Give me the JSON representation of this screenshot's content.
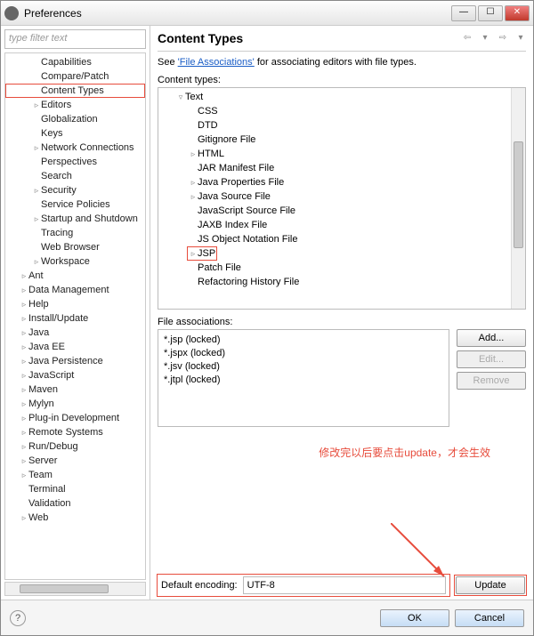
{
  "window": {
    "title": "Preferences"
  },
  "sidebar": {
    "filter_placeholder": "type filter text",
    "items": [
      {
        "label": "Capabilities",
        "depth": 2,
        "exp": ""
      },
      {
        "label": "Compare/Patch",
        "depth": 2,
        "exp": ""
      },
      {
        "label": "Content Types",
        "depth": 2,
        "exp": "",
        "highlight": true
      },
      {
        "label": "Editors",
        "depth": 2,
        "exp": "▹"
      },
      {
        "label": "Globalization",
        "depth": 2,
        "exp": ""
      },
      {
        "label": "Keys",
        "depth": 2,
        "exp": ""
      },
      {
        "label": "Network Connections",
        "depth": 2,
        "exp": "▹"
      },
      {
        "label": "Perspectives",
        "depth": 2,
        "exp": ""
      },
      {
        "label": "Search",
        "depth": 2,
        "exp": ""
      },
      {
        "label": "Security",
        "depth": 2,
        "exp": "▹"
      },
      {
        "label": "Service Policies",
        "depth": 2,
        "exp": ""
      },
      {
        "label": "Startup and Shutdown",
        "depth": 2,
        "exp": "▹"
      },
      {
        "label": "Tracing",
        "depth": 2,
        "exp": ""
      },
      {
        "label": "Web Browser",
        "depth": 2,
        "exp": ""
      },
      {
        "label": "Workspace",
        "depth": 2,
        "exp": "▹"
      },
      {
        "label": "Ant",
        "depth": 1,
        "exp": "▹"
      },
      {
        "label": "Data Management",
        "depth": 1,
        "exp": "▹"
      },
      {
        "label": "Help",
        "depth": 1,
        "exp": "▹"
      },
      {
        "label": "Install/Update",
        "depth": 1,
        "exp": "▹"
      },
      {
        "label": "Java",
        "depth": 1,
        "exp": "▹"
      },
      {
        "label": "Java EE",
        "depth": 1,
        "exp": "▹"
      },
      {
        "label": "Java Persistence",
        "depth": 1,
        "exp": "▹"
      },
      {
        "label": "JavaScript",
        "depth": 1,
        "exp": "▹"
      },
      {
        "label": "Maven",
        "depth": 1,
        "exp": "▹"
      },
      {
        "label": "Mylyn",
        "depth": 1,
        "exp": "▹"
      },
      {
        "label": "Plug-in Development",
        "depth": 1,
        "exp": "▹"
      },
      {
        "label": "Remote Systems",
        "depth": 1,
        "exp": "▹"
      },
      {
        "label": "Run/Debug",
        "depth": 1,
        "exp": "▹"
      },
      {
        "label": "Server",
        "depth": 1,
        "exp": "▹"
      },
      {
        "label": "Team",
        "depth": 1,
        "exp": "▹"
      },
      {
        "label": "Terminal",
        "depth": 1,
        "exp": ""
      },
      {
        "label": "Validation",
        "depth": 1,
        "exp": ""
      },
      {
        "label": "Web",
        "depth": 1,
        "exp": "▹"
      }
    ]
  },
  "content": {
    "title": "Content Types",
    "desc_prefix": "See ",
    "desc_link": "'File Associations'",
    "desc_suffix": " for associating editors with file types.",
    "ct_label": "Content types:",
    "ct_items": [
      {
        "label": "Text",
        "depth": 0,
        "exp": "▿"
      },
      {
        "label": "CSS",
        "depth": 1,
        "exp": ""
      },
      {
        "label": "DTD",
        "depth": 1,
        "exp": ""
      },
      {
        "label": "Gitignore File",
        "depth": 1,
        "exp": ""
      },
      {
        "label": "HTML",
        "depth": 1,
        "exp": "▹"
      },
      {
        "label": "JAR Manifest File",
        "depth": 1,
        "exp": ""
      },
      {
        "label": "Java Properties File",
        "depth": 1,
        "exp": "▹"
      },
      {
        "label": "Java Source File",
        "depth": 1,
        "exp": "▹"
      },
      {
        "label": "JavaScript Source File",
        "depth": 1,
        "exp": ""
      },
      {
        "label": "JAXB Index File",
        "depth": 1,
        "exp": ""
      },
      {
        "label": "JS Object Notation File",
        "depth": 1,
        "exp": ""
      },
      {
        "label": "JSP",
        "depth": 1,
        "exp": "▹",
        "highlight": true
      },
      {
        "label": "Patch File",
        "depth": 1,
        "exp": ""
      },
      {
        "label": "Refactoring History File",
        "depth": 1,
        "exp": ""
      }
    ],
    "fa_label": "File associations:",
    "fa_items": [
      "*.jsp (locked)",
      "*.jspx (locked)",
      "*.jsv (locked)",
      "*.jtpl (locked)"
    ],
    "buttons": {
      "add": "Add...",
      "edit": "Edit...",
      "remove": "Remove"
    },
    "annotation": "修改完以后要点击update，才会生效",
    "enc_label": "Default encoding:",
    "enc_value": "UTF-8",
    "update": "Update"
  },
  "footer": {
    "ok": "OK",
    "cancel": "Cancel"
  }
}
